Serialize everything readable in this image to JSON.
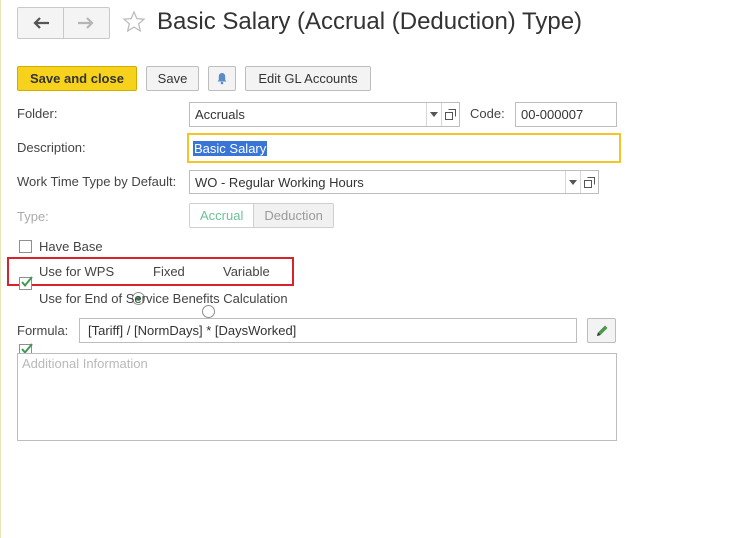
{
  "window": {
    "title": "Basic Salary (Accrual (Deduction) Type)"
  },
  "nav": {
    "back_icon": "arrow-left-icon",
    "forward_icon": "arrow-right-icon",
    "favorite_icon": "star-icon"
  },
  "toolbar": {
    "save_and_close": "Save and close",
    "save": "Save",
    "notification_icon": "bell-icon",
    "edit_gl": "Edit GL Accounts"
  },
  "form": {
    "folder_label": "Folder:",
    "folder_value": "Accruals",
    "code_label": "Code:",
    "code_value": "00-000007",
    "description_label": "Description:",
    "description_value": "Basic Salary",
    "work_time_label": "Work Time Type by Default:",
    "work_time_value": "WO - Regular Working Hours",
    "type_label": "Type:",
    "type_options": [
      "Accrual",
      "Deduction"
    ],
    "type_selected": "Accrual",
    "have_base_label": "Have Base",
    "have_base_checked": false,
    "use_for_wps_label": "Use for WPS",
    "use_for_wps_checked": true,
    "wps_options": [
      "Fixed",
      "Variable"
    ],
    "wps_selected": "Fixed",
    "eosb_label": "Use for End of Service Benefits Calculation",
    "eosb_checked": true,
    "formula_label": "Formula:",
    "formula_value": "[Tariff] /  [NormDays] * [DaysWorked]",
    "additional_info_placeholder": "Additional Information"
  },
  "colors": {
    "primary_button": "#f7d21d",
    "highlight_border": "#d9232b",
    "focus_border": "#f4c52a",
    "selection": "#3875d7",
    "check": "#3c9a55"
  }
}
